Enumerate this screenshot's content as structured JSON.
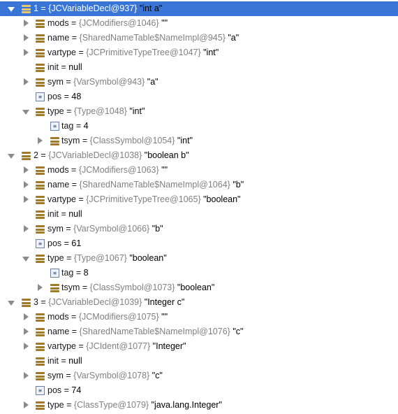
{
  "rows": [
    {
      "level": 0,
      "arrow": "down",
      "icon": "field",
      "name": "1",
      "type": "{JCVariableDecl@937}",
      "value": "\"int a\"",
      "selected": true
    },
    {
      "level": 1,
      "arrow": "right",
      "icon": "field",
      "name": "mods",
      "type": "{JCModifiers@1046}",
      "value": "\"\""
    },
    {
      "level": 1,
      "arrow": "right",
      "icon": "field",
      "name": "name",
      "type": "{SharedNameTable$NameImpl@945}",
      "value": "\"a\""
    },
    {
      "level": 1,
      "arrow": "right",
      "icon": "field",
      "name": "vartype",
      "type": "{JCPrimitiveTypeTree@1047}",
      "value": "\"int\""
    },
    {
      "level": 1,
      "arrow": "none",
      "icon": "field",
      "name": "init",
      "type": "",
      "value": "null"
    },
    {
      "level": 1,
      "arrow": "right",
      "icon": "field",
      "name": "sym",
      "type": "{VarSymbol@943}",
      "value": "\"a\""
    },
    {
      "level": 1,
      "arrow": "none",
      "icon": "prim",
      "name": "pos",
      "type": "",
      "value": "48"
    },
    {
      "level": 1,
      "arrow": "down",
      "icon": "field",
      "name": "type",
      "type": "{Type@1048}",
      "value": "\"int\""
    },
    {
      "level": 2,
      "arrow": "none",
      "icon": "prim",
      "name": "tag",
      "type": "",
      "value": "4"
    },
    {
      "level": 2,
      "arrow": "right",
      "icon": "field",
      "name": "tsym",
      "type": "{ClassSymbol@1054}",
      "value": "\"int\""
    },
    {
      "level": 0,
      "arrow": "down",
      "icon": "field",
      "name": "2",
      "type": "{JCVariableDecl@1038}",
      "value": "\"boolean b\""
    },
    {
      "level": 1,
      "arrow": "right",
      "icon": "field",
      "name": "mods",
      "type": "{JCModifiers@1063}",
      "value": "\"\""
    },
    {
      "level": 1,
      "arrow": "right",
      "icon": "field",
      "name": "name",
      "type": "{SharedNameTable$NameImpl@1064}",
      "value": "\"b\""
    },
    {
      "level": 1,
      "arrow": "right",
      "icon": "field",
      "name": "vartype",
      "type": "{JCPrimitiveTypeTree@1065}",
      "value": "\"boolean\""
    },
    {
      "level": 1,
      "arrow": "none",
      "icon": "field",
      "name": "init",
      "type": "",
      "value": "null"
    },
    {
      "level": 1,
      "arrow": "right",
      "icon": "field",
      "name": "sym",
      "type": "{VarSymbol@1066}",
      "value": "\"b\""
    },
    {
      "level": 1,
      "arrow": "none",
      "icon": "prim",
      "name": "pos",
      "type": "",
      "value": "61"
    },
    {
      "level": 1,
      "arrow": "down",
      "icon": "field",
      "name": "type",
      "type": "{Type@1067}",
      "value": "\"boolean\""
    },
    {
      "level": 2,
      "arrow": "none",
      "icon": "prim",
      "name": "tag",
      "type": "",
      "value": "8"
    },
    {
      "level": 2,
      "arrow": "right",
      "icon": "field",
      "name": "tsym",
      "type": "{ClassSymbol@1073}",
      "value": "\"boolean\""
    },
    {
      "level": 0,
      "arrow": "down",
      "icon": "field",
      "name": "3",
      "type": "{JCVariableDecl@1039}",
      "value": "\"Integer c\""
    },
    {
      "level": 1,
      "arrow": "right",
      "icon": "field",
      "name": "mods",
      "type": "{JCModifiers@1075}",
      "value": "\"\""
    },
    {
      "level": 1,
      "arrow": "right",
      "icon": "field",
      "name": "name",
      "type": "{SharedNameTable$NameImpl@1076}",
      "value": "\"c\""
    },
    {
      "level": 1,
      "arrow": "right",
      "icon": "field",
      "name": "vartype",
      "type": "{JCIdent@1077}",
      "value": "\"Integer\""
    },
    {
      "level": 1,
      "arrow": "none",
      "icon": "field",
      "name": "init",
      "type": "",
      "value": "null"
    },
    {
      "level": 1,
      "arrow": "right",
      "icon": "field",
      "name": "sym",
      "type": "{VarSymbol@1078}",
      "value": "\"c\""
    },
    {
      "level": 1,
      "arrow": "none",
      "icon": "prim",
      "name": "pos",
      "type": "",
      "value": "74"
    },
    {
      "level": 1,
      "arrow": "right",
      "icon": "field",
      "name": "type",
      "type": "{ClassType@1079}",
      "value": "\"java.lang.Integer\""
    }
  ],
  "icons": {
    "field": "field-icon",
    "prim": "primitive-icon",
    "down": "expanded-arrow-icon",
    "right": "collapsed-arrow-icon"
  }
}
